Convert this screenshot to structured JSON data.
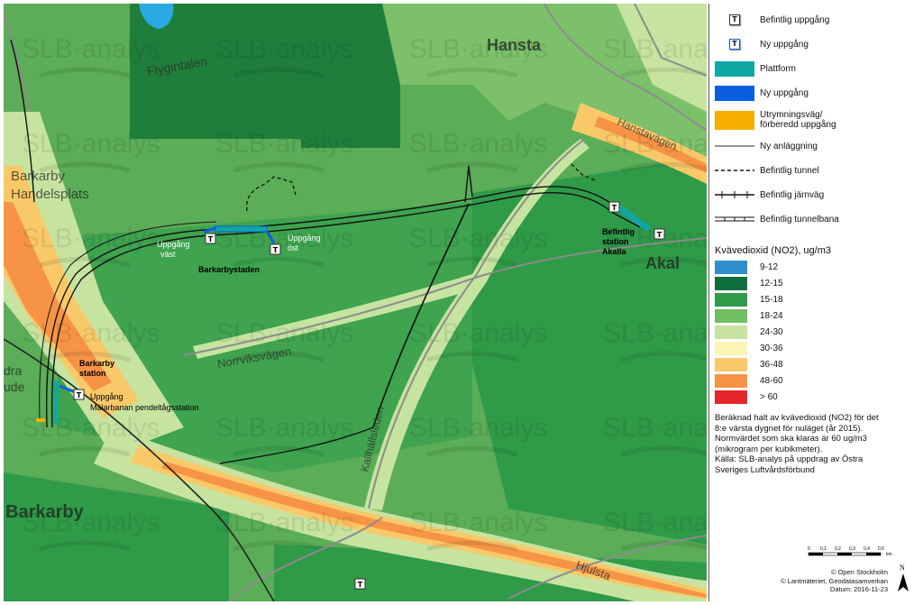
{
  "map": {
    "watermark": "SLB·analys",
    "places": {
      "hansta": "Hansta",
      "akalla": "Akal",
      "barkarby_handelsplats_1": "Barkarby",
      "barkarby_handelsplats_2": "Handelsplats",
      "barkarby": "Barkarby",
      "fragment_1": "dra",
      "fragment_2": "ude"
    },
    "roads": {
      "flygintalen": "Flygintalen",
      "norrviksvagen": "Norrviksvägen",
      "kallhallsleden": "Kallhällsleden",
      "hanstavagen": "Hanstavägen",
      "hjulsta": "Hjulsta"
    },
    "stations": {
      "uppgang_vast_1": "Uppgång",
      "uppgang_vast_2": "väst",
      "barkarbystaden": "Barkarbystaden",
      "uppgang_ost_1": "Uppgång",
      "uppgang_ost_2": "öst",
      "akalla_1": "Befintlig",
      "akalla_2": "station",
      "akalla_3": "Akalla",
      "barkarby_station_1": "Barkarby",
      "barkarby_station_2": "station",
      "malarbanan_1": "Uppgång",
      "malarbanan_2": "Mälarbanan pendeltågsstation"
    },
    "t_symbol": "T"
  },
  "legend": {
    "items": [
      {
        "label": "Befintlig uppgång"
      },
      {
        "label": "Ny uppgång"
      },
      {
        "label": "Plattform",
        "color": "#10a7a4"
      },
      {
        "label": "Ny uppgång",
        "color": "#0a5fe0"
      },
      {
        "label_1": "Utrymningsväg/",
        "label_2": "förberedd uppgång",
        "color": "#f6ae00"
      },
      {
        "label": "Ny anläggning"
      },
      {
        "label": "Befintlig tunnel"
      },
      {
        "label": "Befintlig järnväg"
      },
      {
        "label": "Befintlig tunnelbana"
      }
    ],
    "concentration_title": "Kvävedioxid (NO2), ug/m3",
    "classes": [
      {
        "label": "9-12",
        "color": "#2f8fcc"
      },
      {
        "label": "12-15",
        "color": "#0f6e3d"
      },
      {
        "label": "15-18",
        "color": "#2f9a48"
      },
      {
        "label": "18-24",
        "color": "#6fbe60"
      },
      {
        "label": "24-30",
        "color": "#c7e3a0"
      },
      {
        "label": "30-36",
        "color": "#fbf6b6"
      },
      {
        "label": "36-48",
        "color": "#f9c969"
      },
      {
        "label": "48-60",
        "color": "#f79344"
      },
      {
        "label": "> 60",
        "color": "#e3262a"
      }
    ],
    "note_1": "Beräknad halt av kvävedioxid (NO2) för det",
    "note_2": "8:e värsta dygnet för nuläget (år 2015).",
    "note_3": "Normvärdet som ska klaras är 60 ug/m3",
    "note_4": "(mikrogram per kubikmeter).",
    "note_5": "Källa: SLB-analys på uppdrag av Östra",
    "note_6": "Sveriges Luftvårdsförbund",
    "scale_ticks": [
      "0",
      "0,1",
      "0,2",
      "0,3",
      "0,4",
      "0,5"
    ],
    "scale_unit": "km",
    "north": "N",
    "credit_1": "© Open Stockholm",
    "credit_2": "© Lantmäteriet, Geodatasamverkan",
    "credit_3": "Datum: 2016-11-23"
  }
}
